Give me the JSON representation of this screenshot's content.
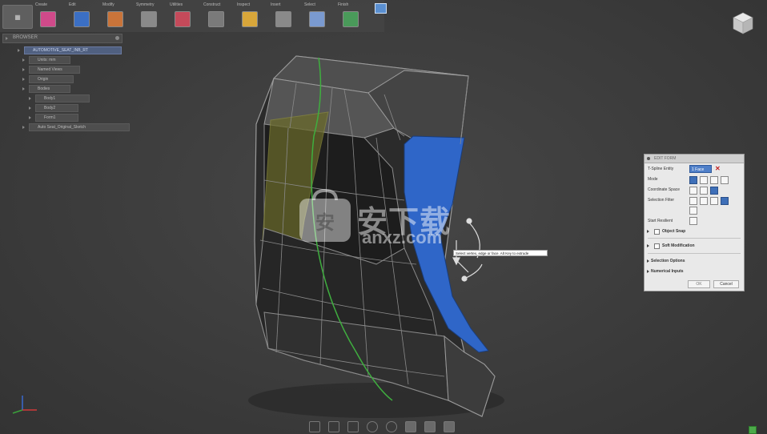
{
  "toolbar": {
    "workspace_icon": "tspline-form-icon",
    "tabs": [
      {
        "label": "Create",
        "icon": "create-form-icon",
        "color": "#d04a8a"
      },
      {
        "label": "Edit",
        "icon": "edit-form-icon",
        "color": "#3b6fc4"
      },
      {
        "label": "Modify",
        "icon": "modify-icon",
        "color": "#c9743a"
      },
      {
        "label": "Symmetry",
        "icon": "symmetry-icon",
        "color": "#8a8a8a"
      },
      {
        "label": "Utilities",
        "icon": "utilities-icon",
        "color": "#c44a5a"
      },
      {
        "label": "Construct",
        "icon": "construct-icon",
        "color": "#7a7a7a"
      },
      {
        "label": "Inspect",
        "icon": "inspect-icon",
        "color": "#d8a63a"
      },
      {
        "label": "Insert",
        "icon": "insert-icon",
        "color": "#8a8a8a"
      },
      {
        "label": "Select",
        "icon": "select-icon",
        "color": "#7a9ad0"
      },
      {
        "label": "Finish",
        "icon": "finish-form-icon",
        "color": "#4a9a5a"
      }
    ]
  },
  "browser": {
    "title": "BROWSER",
    "nodes": [
      {
        "label": "AUTOMOTIVE_SEAT_INB_RT",
        "root": true
      },
      {
        "label": "Units: mm"
      },
      {
        "label": "Named Views"
      },
      {
        "label": "Origin"
      },
      {
        "label": "Bodies"
      },
      {
        "label": "Body1"
      },
      {
        "label": "Body2"
      },
      {
        "label": "Form1"
      },
      {
        "label": "Auto Seat_Original_Sketch"
      }
    ]
  },
  "edit_form": {
    "title": "EDIT FORM",
    "rows": [
      {
        "label": "T-Spline Entity"
      },
      {
        "label": "Mode"
      },
      {
        "label": "Coordinate Space"
      },
      {
        "label": "Selection Filter"
      },
      {
        "label": "Start Resilient"
      }
    ],
    "entity_value": "1 Face",
    "sections": [
      {
        "label": "Object Snap"
      },
      {
        "label": "Soft Modification"
      },
      {
        "label": "Selection Options"
      },
      {
        "label": "Numerical Inputs"
      }
    ],
    "ok_label": "OK",
    "cancel_label": "Cancel"
  },
  "tooltip": "Select vertex, edge or face. Alt Key to extrude",
  "watermark": {
    "text": "安下载",
    "url": "anxz.com"
  },
  "colors": {
    "selected_face": "#2f66c8",
    "sketch_fill": "#6a6a2a",
    "spine_edge": "#3fae3f",
    "accent": "#3e6fb8"
  },
  "navbar": [
    "orbit-icon",
    "look-at-icon",
    "pan-icon",
    "zoom-icon",
    "fit-icon",
    "display-settings-icon",
    "grid-settings-icon",
    "viewports-icon"
  ]
}
